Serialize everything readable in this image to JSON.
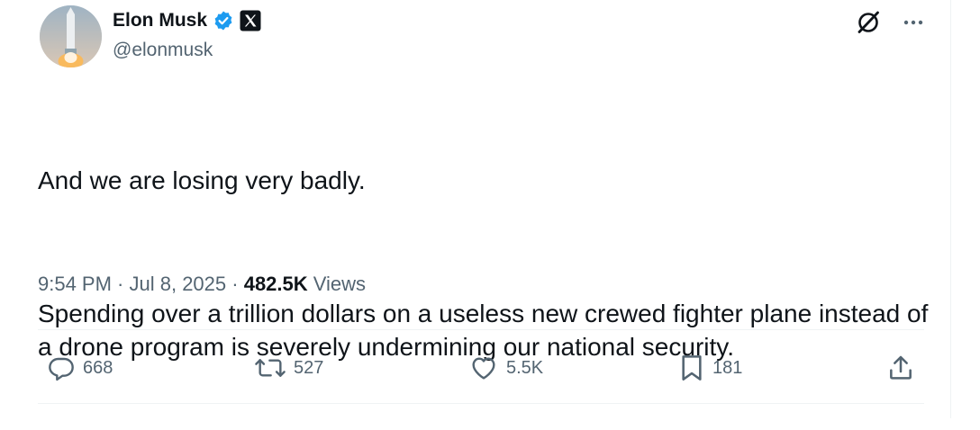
{
  "author": {
    "display_name": "Elon Musk",
    "handle": "@elonmusk",
    "verified_color": "#1d9bf0",
    "affiliate_badge": "x-logo-icon"
  },
  "tweet": {
    "paragraphs": [
      "And we are losing very badly.",
      "Spending over a trillion dollars on a useless new crewed fighter plane instead of a drone program is severely undermining our national security."
    ]
  },
  "meta": {
    "time": "9:54 PM",
    "separator": " · ",
    "date": "Jul 8, 2025",
    "views_count": "482.5K",
    "views_label": " Views"
  },
  "actions": {
    "reply_count": "668",
    "repost_count": "527",
    "like_count": "5.5K",
    "bookmark_count": "181"
  },
  "colors": {
    "text_primary": "#0f1419",
    "text_secondary": "#536471",
    "accent": "#1d9bf0",
    "divider": "#eff3f4"
  }
}
